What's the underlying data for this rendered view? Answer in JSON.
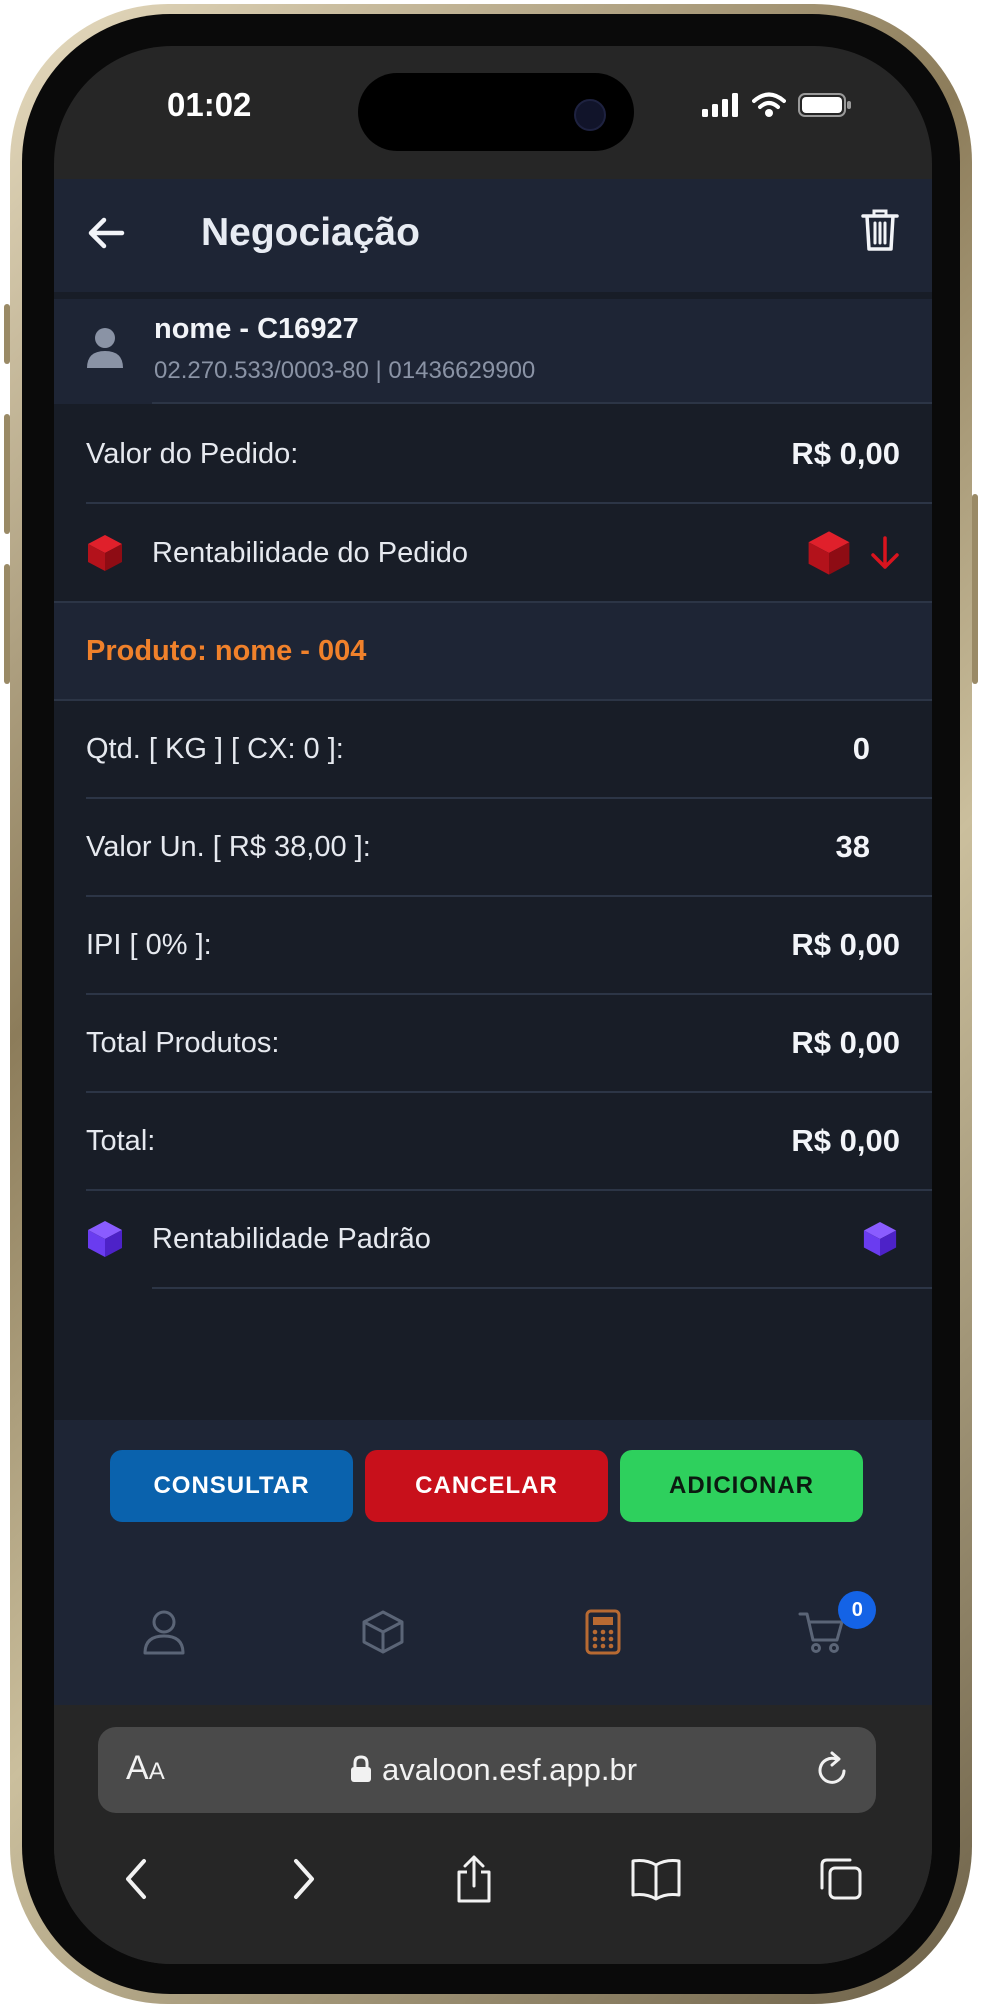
{
  "status_bar": {
    "time": "01:02"
  },
  "header": {
    "title": "Negociação"
  },
  "client": {
    "name": "nome - C16927",
    "doc": "02.270.533/0003-80 | 01436629900"
  },
  "order": {
    "valor_label": "Valor do Pedido:",
    "valor_value": "R$ 0,00",
    "rentabilidade_label": "Rentabilidade do Pedido"
  },
  "product": {
    "title": "Produto: nome - 004",
    "qtd_label": "Qtd. [ KG ] [ CX: 0 ]:",
    "qtd_value": "0",
    "valor_un_label": "Valor Un. [ R$ 38,00 ]:",
    "valor_un_value": "38",
    "ipi_label": "IPI [ 0% ]:",
    "ipi_value": "R$ 0,00",
    "total_produtos_label": "Total Produtos:",
    "total_produtos_value": "R$ 0,00",
    "total_label": "Total:",
    "total_value": "R$ 0,00",
    "rentabilidade_padrao_label": "Rentabilidade Padrão"
  },
  "actions": {
    "consultar": "CONSULTAR",
    "cancelar": "CANCELAR",
    "adicionar": "ADICIONAR"
  },
  "tabbar": {
    "cart_count": "0",
    "active_tab": "calculator"
  },
  "browser": {
    "aa_big": "A",
    "aa_small": "A",
    "url": "avaloon.esf.app.br"
  },
  "colors": {
    "accent_orange": "#f0812b",
    "red": "#c8101b",
    "blue": "#0a62ad",
    "green": "#2ed05d",
    "purple": "#6a3cf0"
  }
}
